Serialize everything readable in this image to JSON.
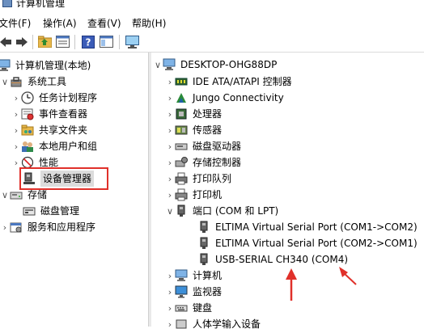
{
  "window": {
    "title": "计算机管理"
  },
  "menu": [
    "文件(F)",
    "操作(A)",
    "查看(V)",
    "帮助(H)"
  ],
  "toolbar": {
    "buttons": [
      "back-icon",
      "forward-icon",
      "up-folder-icon",
      "properties-icon",
      "help-icon",
      "show-hide-icon",
      "monitor-icon"
    ]
  },
  "left_tree": {
    "root": "计算机管理(本地)",
    "system_tools": "系统工具",
    "task_scheduler": "任务计划程序",
    "event_viewer": "事件查看器",
    "shared_folders": "共享文件夹",
    "local_users": "本地用户和组",
    "performance": "性能",
    "device_manager": "设备管理器",
    "storage": "存储",
    "disk_management": "磁盘管理",
    "services_apps": "服务和应用程序"
  },
  "device_tree": {
    "computer": "DESKTOP-OHG88DP",
    "categories": {
      "ide": "IDE ATA/ATAPI 控制器",
      "jungo": "Jungo Connectivity",
      "processors": "处理器",
      "sensors": "传感器",
      "disk_drives": "磁盘驱动器",
      "storage_ctrl": "存储控制器",
      "print_queues": "打印队列",
      "printers": "打印机",
      "ports": "端口 (COM 和 LPT)",
      "computer": "计算机",
      "monitors": "监视器",
      "keyboards": "键盘",
      "hid": "人体学输入设备"
    },
    "ports": [
      "ELTIMA Virtual Serial Port (COM1->COM2)",
      "ELTIMA Virtual Serial Port (COM2->COM1)",
      "USB-SERIAL CH340 (COM4)"
    ]
  },
  "colors": {
    "highlight": "#e0302a",
    "selection": "#dcdcdc"
  }
}
